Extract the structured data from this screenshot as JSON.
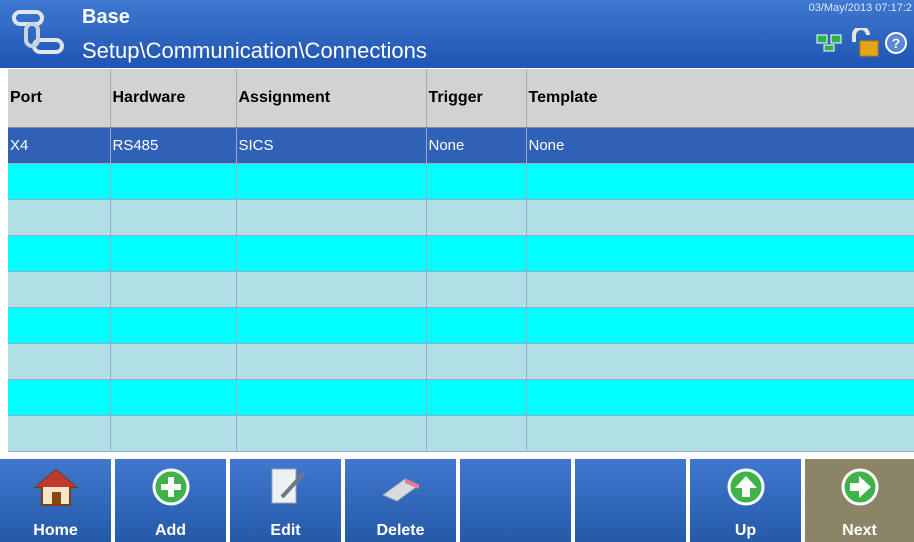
{
  "header": {
    "title": "Base",
    "path": "Setup\\Communication\\Connections",
    "datetime": "03/May/2013 07:17:2"
  },
  "table": {
    "columns": [
      "Port",
      "Hardware",
      "Assignment",
      "Trigger",
      "Template"
    ],
    "rows": [
      [
        "X4",
        "RS485",
        "SICS",
        "None",
        "None"
      ],
      [
        "",
        "",
        "",
        "",
        ""
      ],
      [
        "",
        "",
        "",
        "",
        ""
      ],
      [
        "",
        "",
        "",
        "",
        ""
      ],
      [
        "",
        "",
        "",
        "",
        ""
      ],
      [
        "",
        "",
        "",
        "",
        ""
      ],
      [
        "",
        "",
        "",
        "",
        ""
      ],
      [
        "",
        "",
        "",
        "",
        ""
      ],
      [
        "",
        "",
        "",
        "",
        ""
      ]
    ]
  },
  "softkeys": [
    {
      "label": "Home",
      "icon": "home-icon"
    },
    {
      "label": "Add",
      "icon": "add-icon"
    },
    {
      "label": "Edit",
      "icon": "edit-icon"
    },
    {
      "label": "Delete",
      "icon": "eraser-icon"
    },
    {
      "label": "",
      "icon": ""
    },
    {
      "label": "",
      "icon": ""
    },
    {
      "label": "Up",
      "icon": "arrow-up-icon"
    },
    {
      "label": "Next",
      "icon": "arrow-right-icon"
    }
  ],
  "colors": {
    "header": "#1f55b3",
    "selected_row": "#2f62b6",
    "row_cyan": "#00ffff",
    "row_light": "#b0e0e6",
    "next_button": "#8c8466"
  }
}
